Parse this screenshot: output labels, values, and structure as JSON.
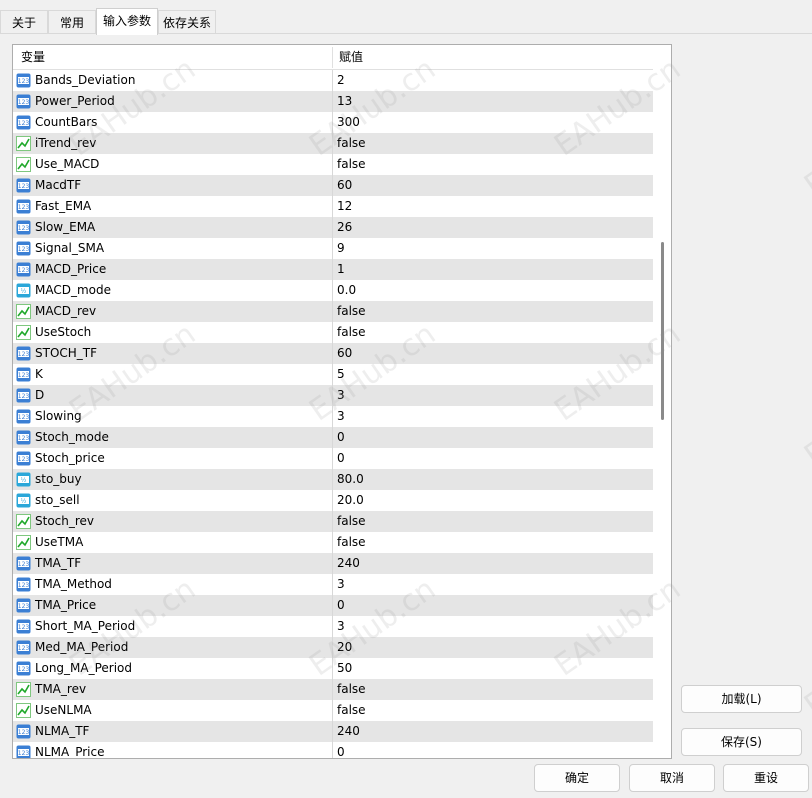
{
  "tabs": [
    "关于",
    "常用",
    "输入参数",
    "依存关系"
  ],
  "active_tab": "输入参数",
  "grid": {
    "columns": [
      "变量",
      "赋值"
    ],
    "rows": [
      {
        "icon": "int-icon",
        "name": "Bands_Deviation",
        "value": "2"
      },
      {
        "icon": "int-icon",
        "name": "Power_Period",
        "value": "13"
      },
      {
        "icon": "int-icon",
        "name": "CountBars",
        "value": "300"
      },
      {
        "icon": "bool-icon",
        "name": "iTrend_rev",
        "value": "false"
      },
      {
        "icon": "bool-icon",
        "name": "Use_MACD",
        "value": "false"
      },
      {
        "icon": "int-icon",
        "name": "MacdTF",
        "value": "60"
      },
      {
        "icon": "int-icon",
        "name": "Fast_EMA",
        "value": "12"
      },
      {
        "icon": "int-icon",
        "name": "Slow_EMA",
        "value": "26"
      },
      {
        "icon": "int-icon",
        "name": "Signal_SMA",
        "value": "9"
      },
      {
        "icon": "int-icon",
        "name": "MACD_Price",
        "value": "1"
      },
      {
        "icon": "double-icon",
        "name": "MACD_mode",
        "value": "0.0"
      },
      {
        "icon": "bool-icon",
        "name": "MACD_rev",
        "value": "false"
      },
      {
        "icon": "bool-icon",
        "name": "UseStoch",
        "value": "false"
      },
      {
        "icon": "int-icon",
        "name": "STOCH_TF",
        "value": "60"
      },
      {
        "icon": "int-icon",
        "name": "K",
        "value": "5"
      },
      {
        "icon": "int-icon",
        "name": "D",
        "value": "3"
      },
      {
        "icon": "int-icon",
        "name": "Slowing",
        "value": "3"
      },
      {
        "icon": "int-icon",
        "name": "Stoch_mode",
        "value": "0"
      },
      {
        "icon": "int-icon",
        "name": "Stoch_price",
        "value": "0"
      },
      {
        "icon": "double-icon",
        "name": "sto_buy",
        "value": "80.0"
      },
      {
        "icon": "double-icon",
        "name": "sto_sell",
        "value": "20.0"
      },
      {
        "icon": "bool-icon",
        "name": "Stoch_rev",
        "value": "false"
      },
      {
        "icon": "bool-icon",
        "name": "UseTMA",
        "value": "false"
      },
      {
        "icon": "int-icon",
        "name": "TMA_TF",
        "value": "240"
      },
      {
        "icon": "int-icon",
        "name": "TMA_Method",
        "value": "3"
      },
      {
        "icon": "int-icon",
        "name": "TMA_Price",
        "value": "0"
      },
      {
        "icon": "int-icon",
        "name": "Short_MA_Period",
        "value": "3"
      },
      {
        "icon": "int-icon",
        "name": "Med_MA_Period",
        "value": "20"
      },
      {
        "icon": "int-icon",
        "name": "Long_MA_Period",
        "value": "50"
      },
      {
        "icon": "bool-icon",
        "name": "TMA_rev",
        "value": "false"
      },
      {
        "icon": "bool-icon",
        "name": "UseNLMA",
        "value": "false"
      },
      {
        "icon": "int-icon",
        "name": "NLMA_TF",
        "value": "240"
      },
      {
        "icon": "int-icon",
        "name": "NLMA_Price",
        "value": "0"
      }
    ]
  },
  "buttons": {
    "load": "加载(L)",
    "save": "保存(S)",
    "ok": "确定",
    "cancel": "取消",
    "reset": "重设"
  },
  "watermark": "EAHub.cn",
  "colors": {
    "int_icon_bg": "#3b7fd4",
    "bool_icon_line": "#1fa82a",
    "double_icon_bg": "#2aa7d9",
    "alt_row": "#e5e5e5"
  }
}
